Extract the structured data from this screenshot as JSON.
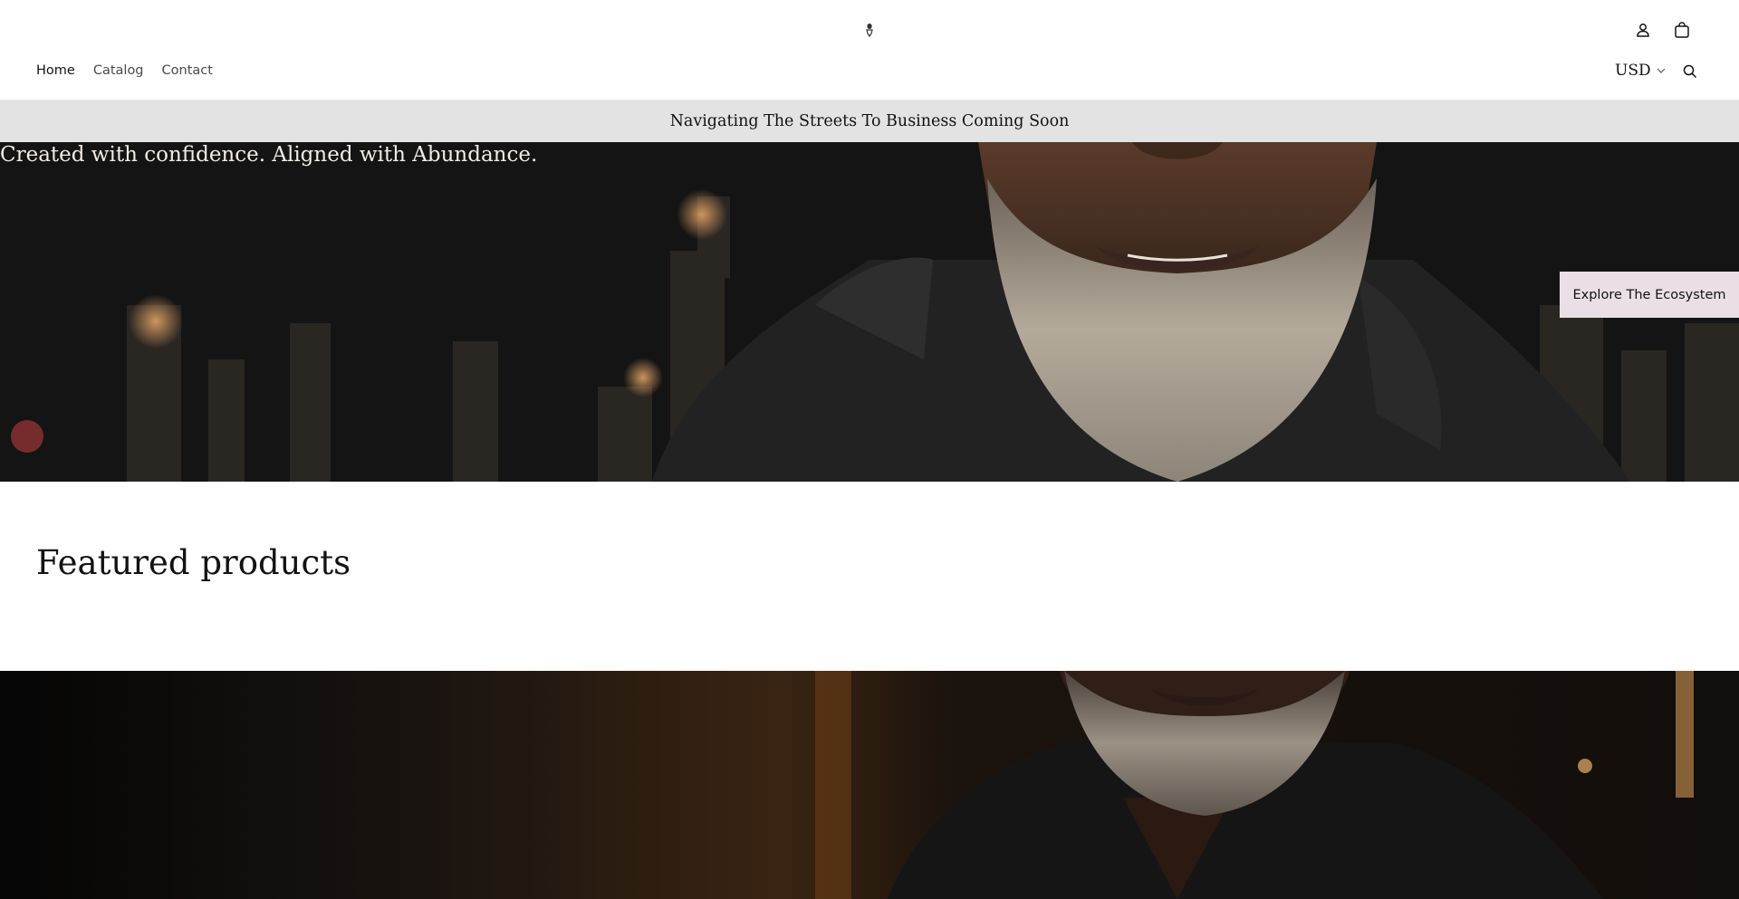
{
  "header": {
    "logo_icon": "brand-logo-icon",
    "nav": [
      {
        "label": "Home",
        "active": true
      },
      {
        "label": "Catalog",
        "active": false
      },
      {
        "label": "Contact",
        "active": false
      }
    ],
    "currency": {
      "selected": "USD"
    },
    "icons": [
      "account-icon",
      "cart-icon",
      "search-icon",
      "chevron-down-icon"
    ]
  },
  "announcement": {
    "text": "Navigating The Streets To Business Coming Soon"
  },
  "hero": {
    "tagline": "Created with confidence. Aligned with Abundance.",
    "button_label": "Explore The Ecosystem",
    "image": "man-with-grey-beard-in-black-hoodie-city-night-skyline"
  },
  "featured": {
    "heading": "Featured products"
  },
  "banner2": {
    "image": "man-with-grey-beard-in-black-polo-night"
  },
  "colors": {
    "announcement_bg": "#e3e3e3",
    "button_bg": "#e9dfe5",
    "text": "#121212"
  }
}
